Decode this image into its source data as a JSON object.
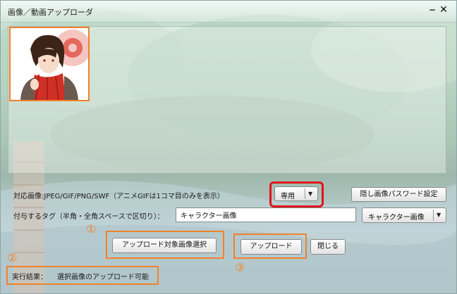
{
  "window": {
    "title": "画像／動画アップローダ",
    "minimize_label": "−",
    "close_label": "✕"
  },
  "formats": {
    "label": "対応画像:JPEG/GIF/PNG/SWF（アニメGIFは1コマ目のみを表示）"
  },
  "mode_select": {
    "value": "専用",
    "arrow": "▼"
  },
  "password_button": {
    "label": "隠し画像パスワード設定"
  },
  "tags": {
    "label": "付与するタグ（半角・全角スペースで区切り）：",
    "value": "キャラクター画像",
    "preset_value": "キャラクター画像",
    "preset_arrow": "▼"
  },
  "actions": {
    "select_label": "アップロード対象画像選択",
    "upload_label": "アップロード",
    "close_label": "閉じる"
  },
  "result": {
    "label": "実行結果：",
    "message": "選択画像のアップロード可能"
  },
  "annotations": {
    "one": "①",
    "two": "②",
    "three": "③"
  },
  "colors": {
    "annotation_orange": "#f0822b",
    "annotation_red": "#e0141c"
  }
}
